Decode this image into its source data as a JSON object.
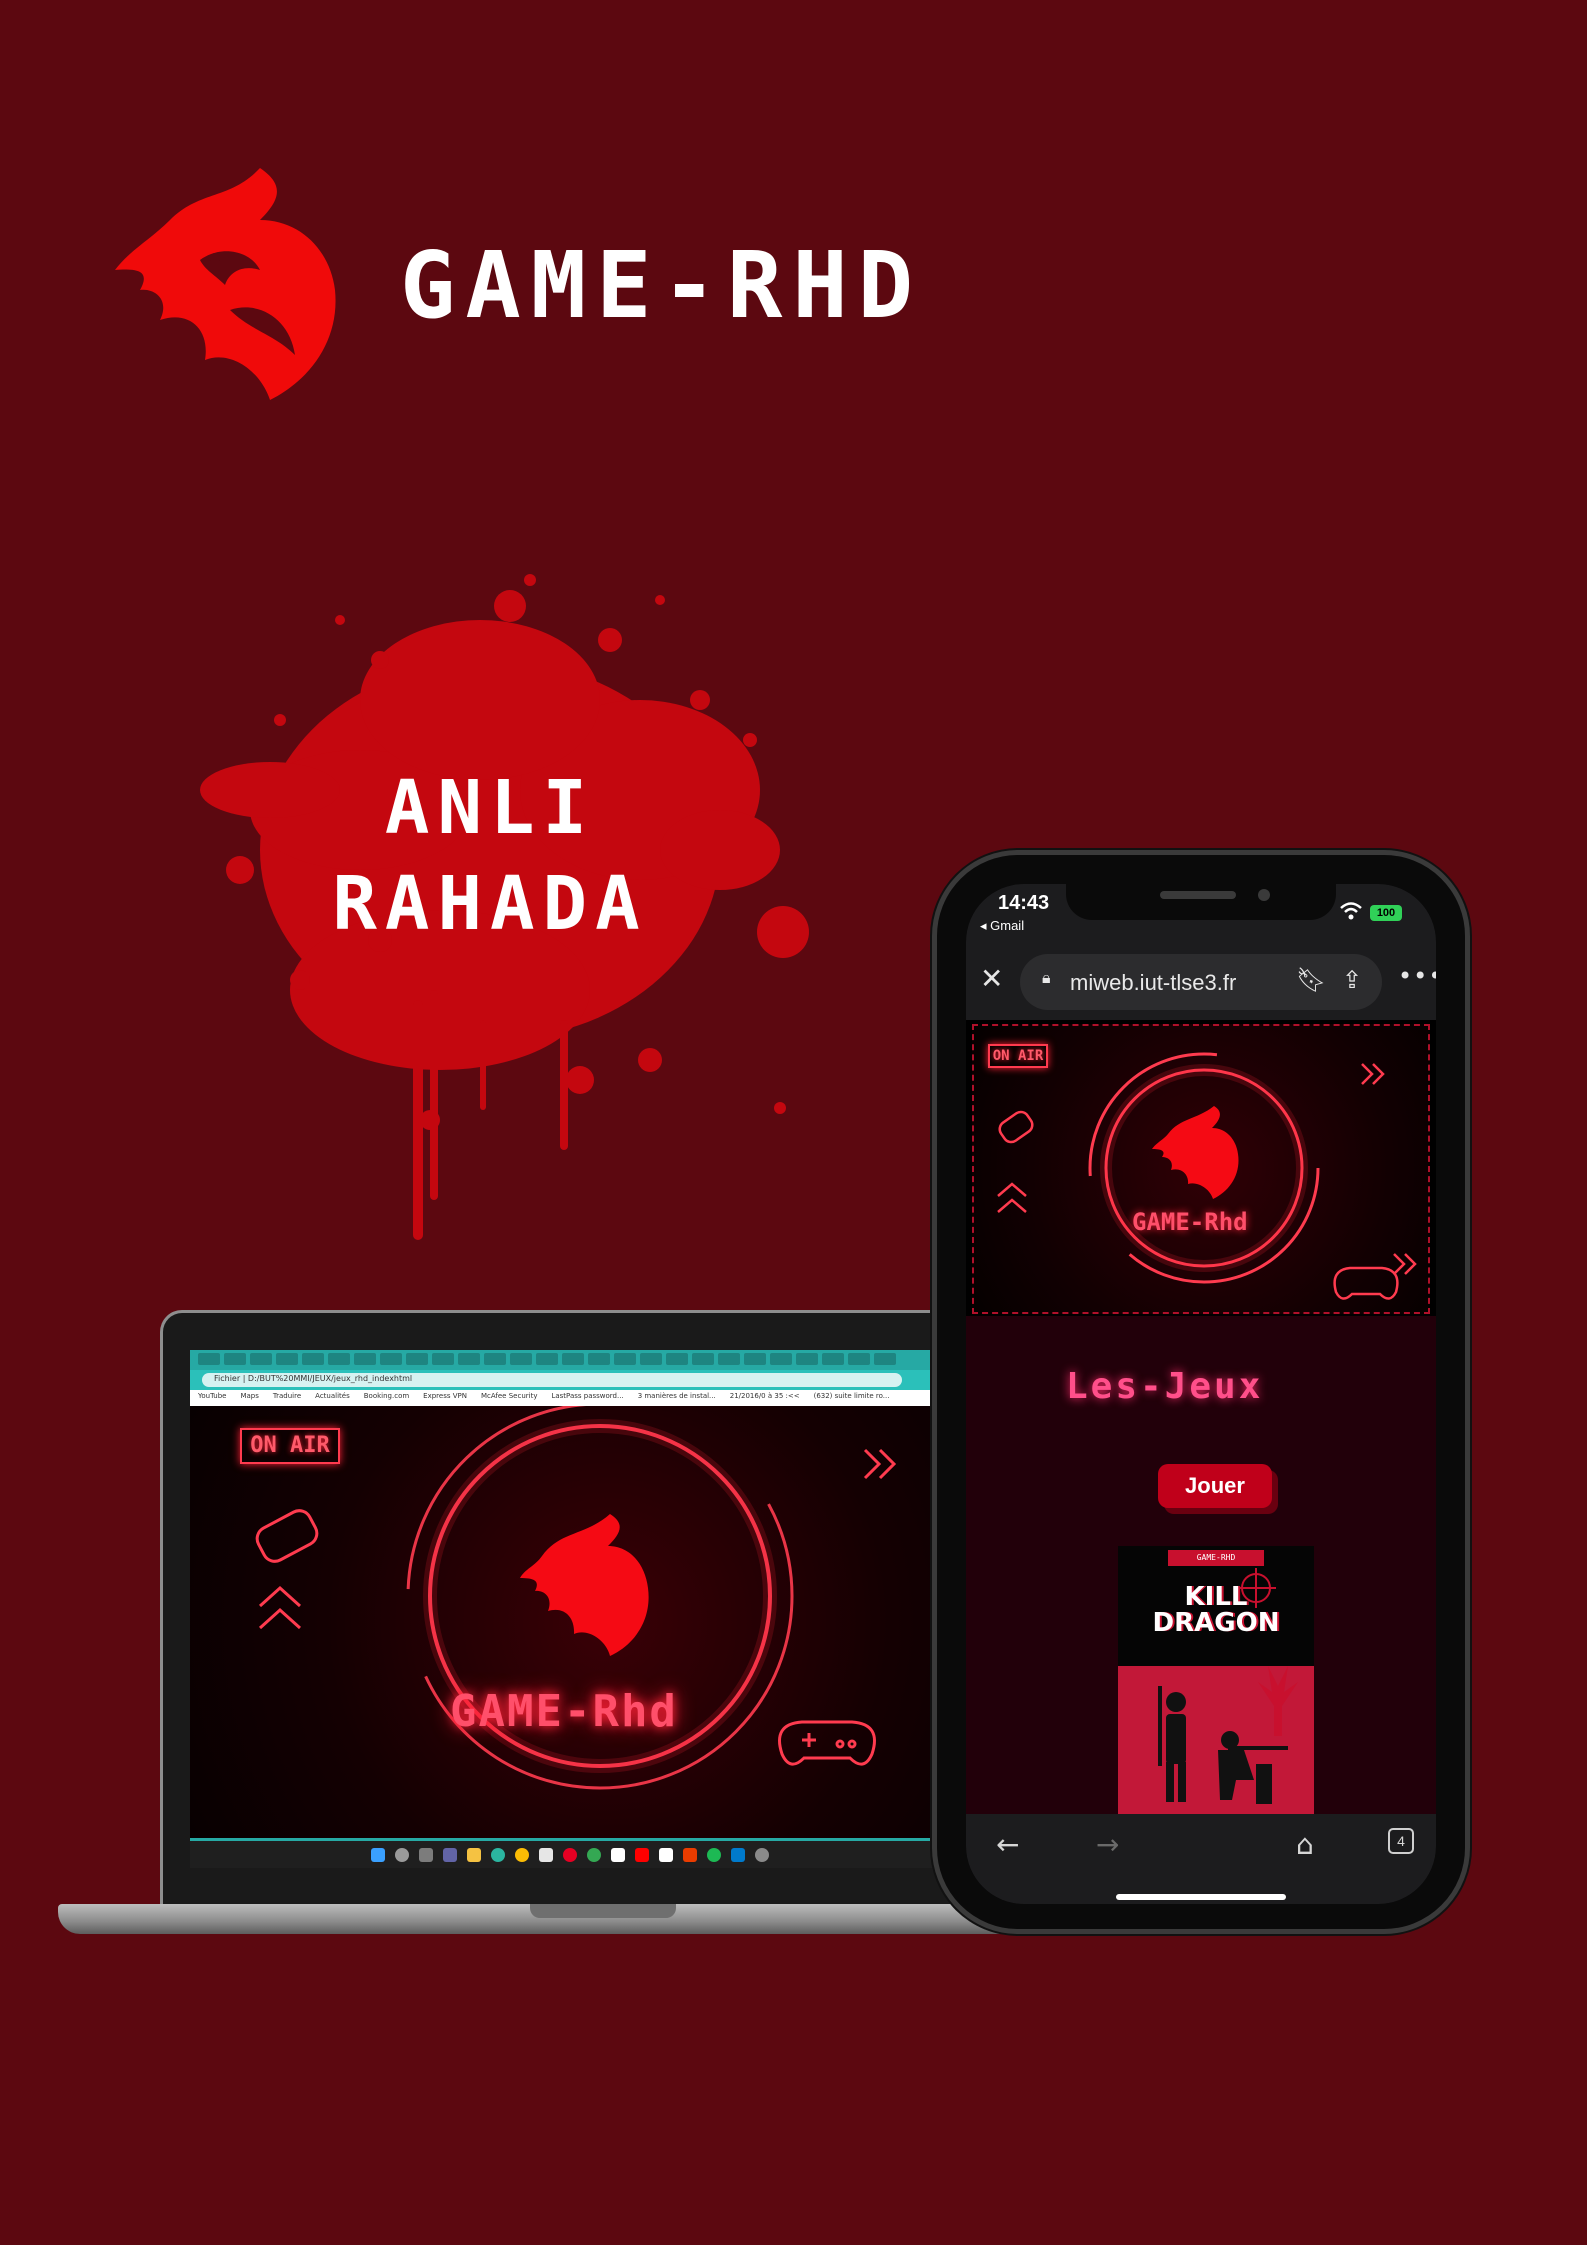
{
  "brand": {
    "title": "GAME-RHD"
  },
  "splash": {
    "line1": "ANLI",
    "line2": "RAHADA"
  },
  "laptop": {
    "address": "Fichier  |  D:/BUT%20MMI/JEUX/jeux_rhd_indexhtml",
    "bookmarks": [
      "YouTube",
      "Maps",
      "Traduire",
      "Actualités",
      "Booking.com",
      "Express VPN",
      "McAfee Security",
      "LastPass password...",
      "3 manières de instal...",
      "21/2016/0 à 35 :<<",
      "(632) suite limite ro..."
    ],
    "onair": "ON AIR",
    "logo_text": "GAME-Rhd"
  },
  "phone": {
    "time": "14:43",
    "back_app": "◂ Gmail",
    "battery": "100",
    "url": "miweb.iut-tlse3.fr",
    "onair": "ON AIR",
    "logo_text": "GAME-Rhd",
    "section_title": "Les-Jeux",
    "play_button": "Jouer",
    "card_badge": "GAME-RHD",
    "card_title_1": "KILL",
    "card_title_2": "DRAGON",
    "tabs_count": "4"
  },
  "colors": {
    "background": "#5c0810",
    "neon_red": "#ff2036",
    "accent_pink": "#ff4f8a"
  }
}
